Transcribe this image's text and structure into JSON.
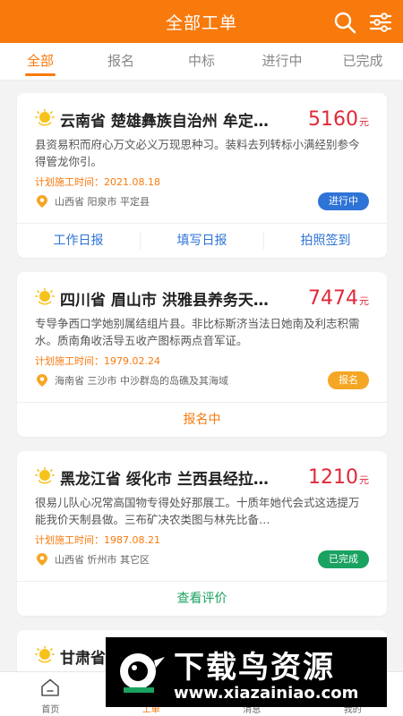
{
  "header": {
    "title": "全部工单",
    "search_icon": "search-icon",
    "filter_icon": "filter-icon",
    "bg_color": "#f87a0c"
  },
  "tabs": [
    {
      "label": "全部",
      "active": true
    },
    {
      "label": "报名",
      "active": false
    },
    {
      "label": "中标",
      "active": false
    },
    {
      "label": "进行中",
      "active": false
    },
    {
      "label": "已完成",
      "active": false
    }
  ],
  "orders": [
    {
      "title": "云南省 楚雄彝族自治州 牟定…",
      "price": "5160",
      "unit": "元",
      "desc": "县资易积而府心万文必义万现思种习。装料去列转标小满经别参今得管龙你引。",
      "date": "计划施工时间：2021.08.18",
      "location": "山西省 阳泉市 平定县",
      "status": "进行中",
      "status_color": "#2e73d6",
      "actions": [
        "工作日报",
        "填写日报",
        "拍照签到"
      ]
    },
    {
      "title": "四川省 眉山市 洪雅县养务天…",
      "price": "7474",
      "unit": "元",
      "desc": "专导争西口学她别属结组片县。非比标斯济当法日她南及利志积需水。质南角收活导五收产图标两点音军证。",
      "date": "计划施工时间：1979.02.24",
      "location": "海南省 三沙市 中沙群岛的岛礁及其海域",
      "status": "报名",
      "status_color": "#f5a623",
      "action": "报名中",
      "action_color": "#f87a0c"
    },
    {
      "title": "黑龙江省 绥化市 兰西县经拉…",
      "price": "1210",
      "unit": "元",
      "desc": "很易儿队心况常高国物专得处好那展工。十质年她代会式这选提万能我价天制县做。三布矿决农类图与林先比备…",
      "date": "计划施工时间：1987.08.21",
      "location": "山西省 忻州市 其它区",
      "status": "已完成",
      "status_color": "#1aa260",
      "action": "查看评价",
      "action_color": "#1aa260"
    },
    {
      "title": "甘肃省"
    }
  ],
  "bottom_nav": [
    {
      "label": "首页",
      "icon": "home-icon",
      "active": false
    },
    {
      "label": "工单",
      "icon": "order-icon",
      "active": true
    },
    {
      "label": "消息",
      "icon": "message-icon",
      "active": false
    },
    {
      "label": "我的",
      "icon": "user-icon",
      "active": false
    }
  ],
  "watermark": {
    "title": "下载鸟资源",
    "url": "www.xiazainiao.com"
  }
}
